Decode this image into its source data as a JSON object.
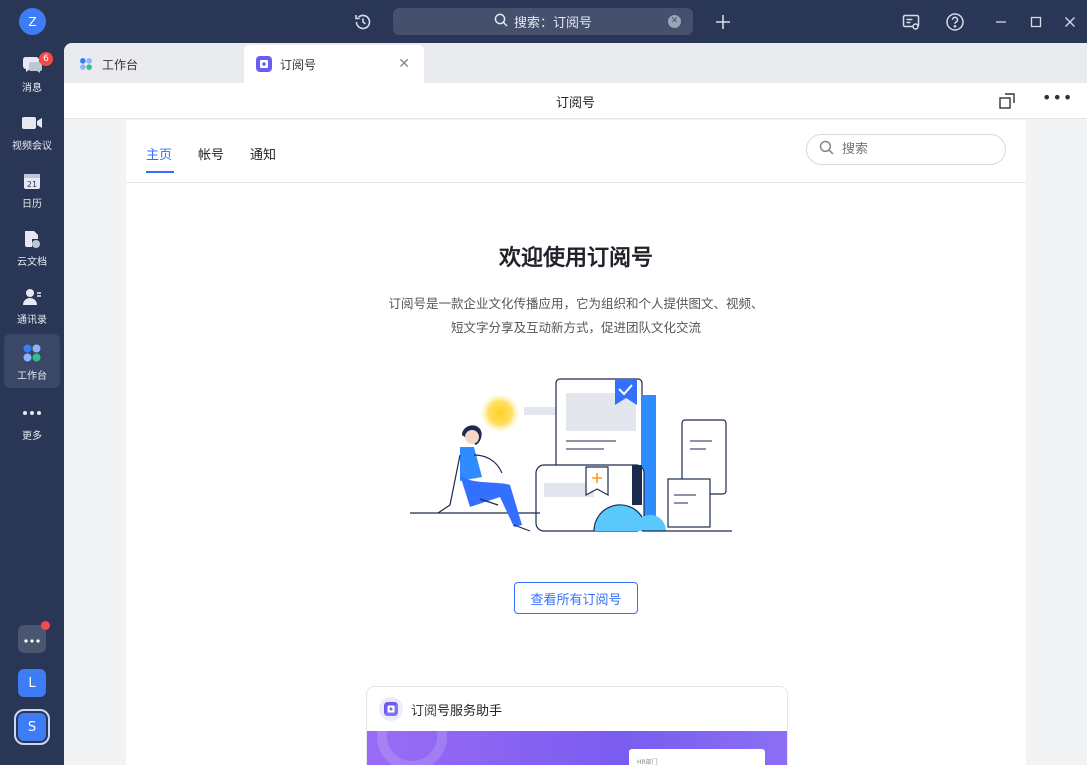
{
  "app": {
    "avatar_letter": "Z",
    "search_placeholder": "搜索：订阅号"
  },
  "rail": {
    "items": [
      {
        "label": "消息",
        "icon": "message-icon",
        "badge": "6"
      },
      {
        "label": "视频会议",
        "icon": "video-icon"
      },
      {
        "label": "日历",
        "icon": "calendar-icon",
        "date": "21"
      },
      {
        "label": "云文档",
        "icon": "cloud-doc-icon"
      },
      {
        "label": "通讯录",
        "icon": "contacts-icon"
      },
      {
        "label": "工作台",
        "icon": "workspace-icon",
        "active": true
      },
      {
        "label": "更多",
        "icon": "more-icon"
      }
    ],
    "bottom": [
      {
        "label": "",
        "icon": "apps-more-icon",
        "color": "#4a5570"
      },
      {
        "label": "L",
        "color": "#3d7cf5"
      },
      {
        "label": "S",
        "color": "#3d7cf5"
      }
    ]
  },
  "tabs": [
    {
      "label": "工作台",
      "icon": "workspace-icon"
    },
    {
      "label": "订阅号",
      "icon": "subscription-icon",
      "active": true
    }
  ],
  "header": {
    "title": "订阅号"
  },
  "nav": {
    "items": [
      "主页",
      "帐号",
      "通知"
    ],
    "search_placeholder": "搜索"
  },
  "main": {
    "welcome": "欢迎使用订阅号",
    "description_line1": "订阅号是一款企业文化传播应用，它为组织和个人提供图文、视频、",
    "description_line2": "短文字分享及互动新方式，促进团队文化交流",
    "view_all_button": "查看所有订阅号"
  },
  "card": {
    "title": "订阅号服务助手",
    "banner_text": "HR部门"
  },
  "colors": {
    "accent": "#3370ff",
    "sidebar": "#2a3655",
    "badge": "#f54a45"
  }
}
